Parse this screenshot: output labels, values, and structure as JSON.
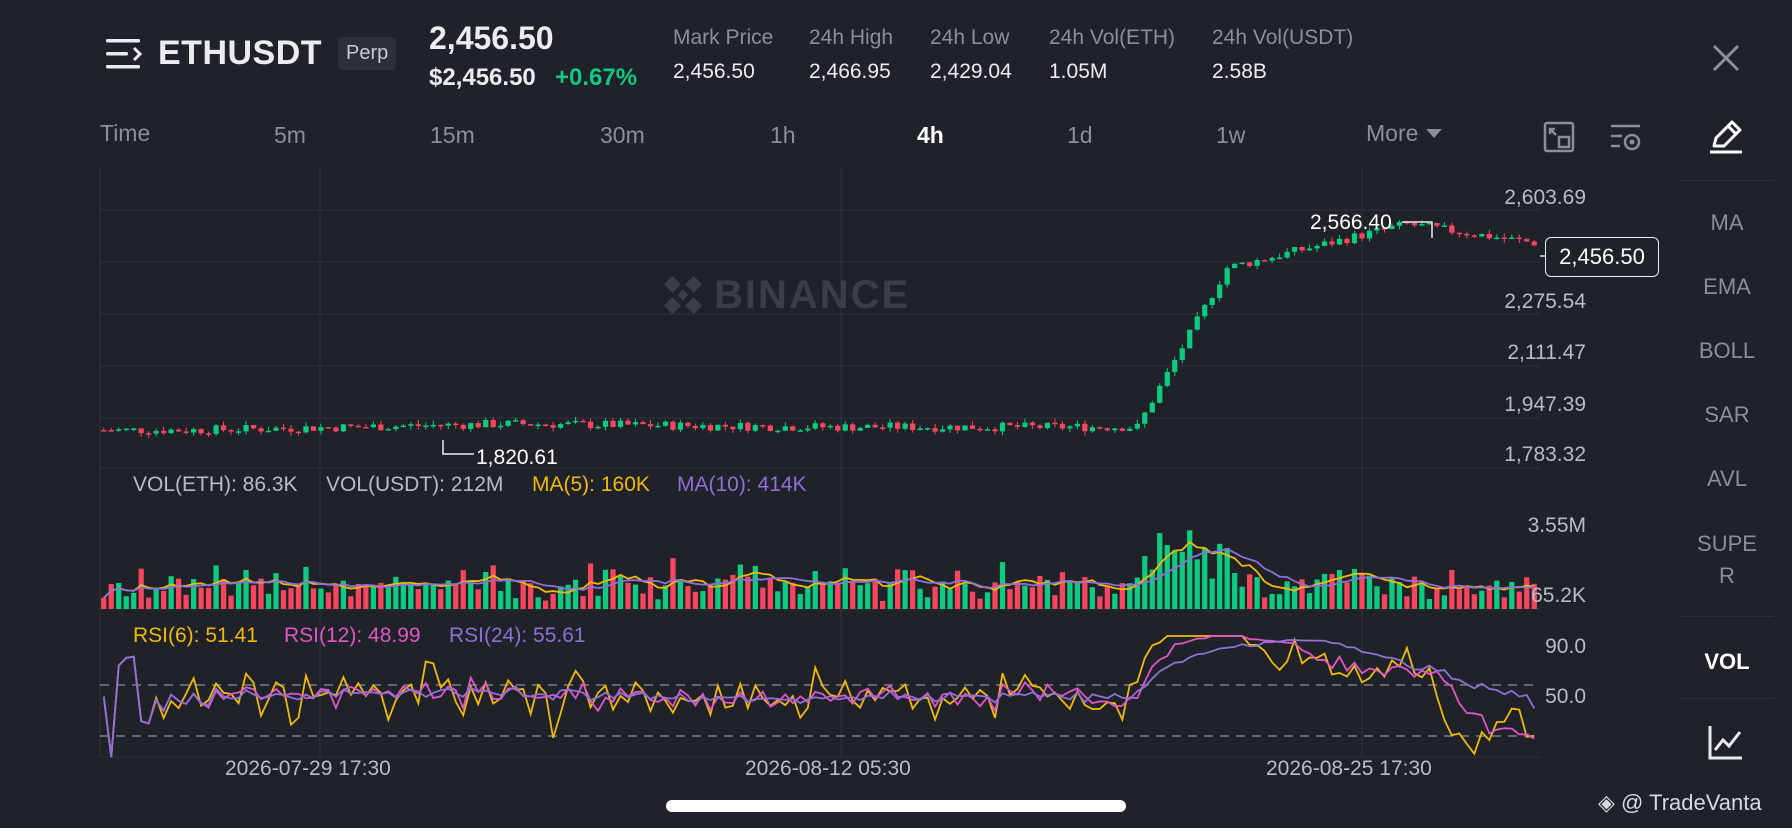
{
  "header": {
    "symbol": "ETHUSDT",
    "contract_type": "Perp",
    "last_price": "2,456.50",
    "last_price_usd": "$2,456.50",
    "change_pct": "+0.67%",
    "stats": [
      {
        "label": "Mark Price",
        "value": "2,456.50"
      },
      {
        "label": "24h High",
        "value": "2,466.95"
      },
      {
        "label": "24h Low",
        "value": "2,429.04"
      },
      {
        "label": "24h Vol(ETH)",
        "value": "1.05M"
      },
      {
        "label": "24h Vol(USDT)",
        "value": "2.58B"
      }
    ]
  },
  "timeframes": {
    "label": "Time",
    "items": [
      "5m",
      "15m",
      "30m",
      "1h",
      "4h",
      "1d",
      "1w"
    ],
    "active": "4h",
    "more_label": "More"
  },
  "price_axis": [
    "2,603.69",
    "2,275.54",
    "2,111.47",
    "1,947.39",
    "1,783.32"
  ],
  "current_price_tag": "2,456.50",
  "annotations": {
    "high": "2,566.40",
    "low": "1,820.61"
  },
  "volume_legend": {
    "vol_eth": "VOL(ETH): 86.3K",
    "vol_usdt": "VOL(USDT): 212M",
    "ma5": "MA(5): 160K",
    "ma10": "MA(10): 414K"
  },
  "volume_axis": [
    "3.55M",
    "65.2K"
  ],
  "rsi_legend": {
    "rsi6": "RSI(6): 51.41",
    "rsi12": "RSI(12): 48.99",
    "rsi24": "RSI(24): 55.61"
  },
  "rsi_axis": [
    "90.0",
    "50.0"
  ],
  "dates": [
    "2026-07-29 17:30",
    "2026-08-12 05:30",
    "2026-08-25 17:30"
  ],
  "indicators": [
    "MA",
    "EMA",
    "BOLL",
    "SAR",
    "AVL",
    "SUPER"
  ],
  "sub_indicators": {
    "active": "VOL"
  },
  "watermark": "BINANCE",
  "brand": "@ TradeVanta",
  "colors": {
    "up": "#0ecb81",
    "down": "#f6465d",
    "rsi6": "#f0b90b",
    "rsi12": "#e056c9",
    "rsi24": "#8f6fd8",
    "background": "#1f2228"
  },
  "icons": [
    "menu-icon",
    "close-icon",
    "fullscreen-icon",
    "chart-settings-icon",
    "draw-icon",
    "line-chart-icon"
  ],
  "chart_data": {
    "type": "candlestick",
    "series_summary": {
      "price_range": [
        1783.32,
        2603.69
      ],
      "low": 1820.61,
      "high": 2566.4,
      "last": 2456.5,
      "profile": [
        {
          "date": "2026-07-29",
          "price": 1860
        },
        {
          "date": "2026-08-05",
          "price": 1880
        },
        {
          "date": "2026-08-12",
          "price": 1870
        },
        {
          "date": "2026-08-19",
          "price": 1870
        },
        {
          "date": "2026-08-21",
          "price": 2380
        },
        {
          "date": "2026-08-25",
          "price": 2520
        },
        {
          "date": "2026-08-28",
          "price": 2456.5
        }
      ]
    }
  }
}
